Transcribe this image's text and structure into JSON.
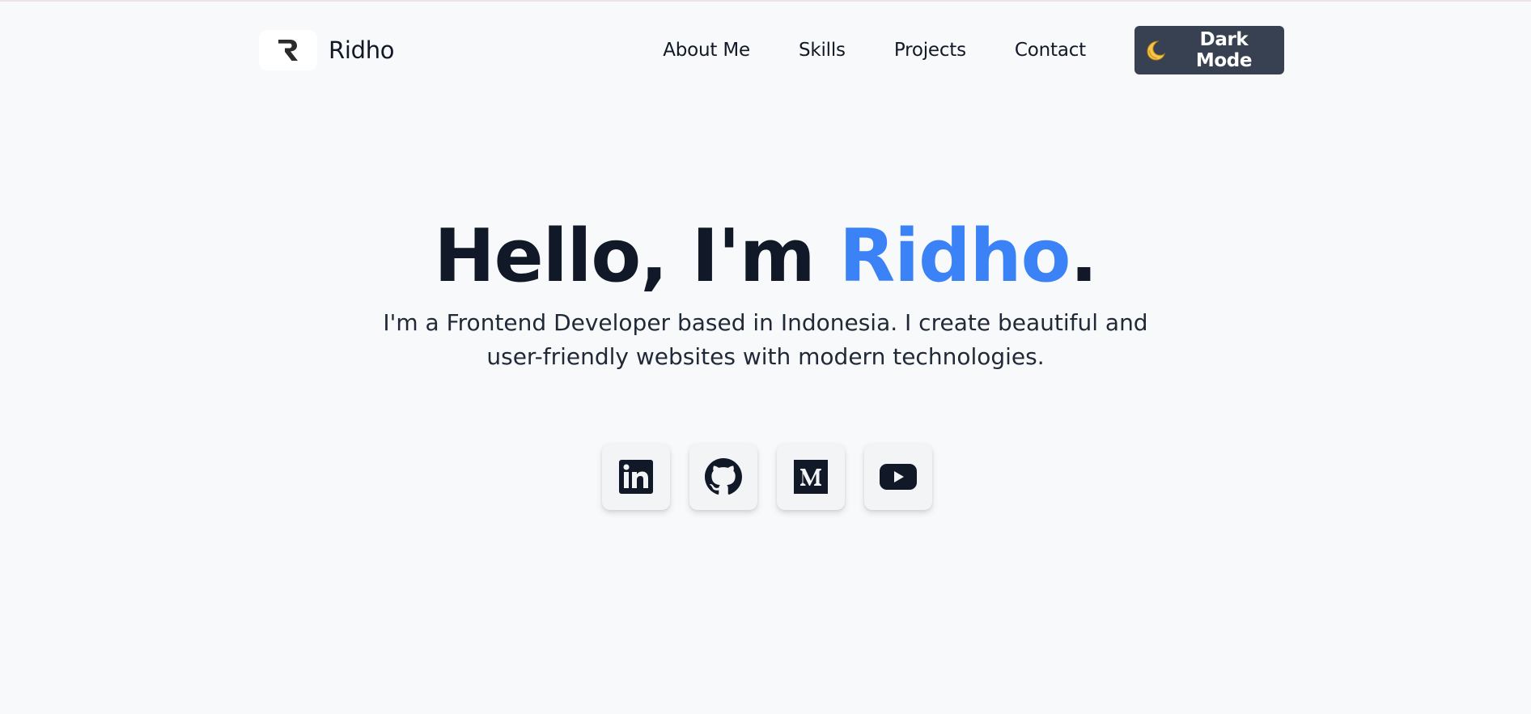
{
  "brand": {
    "name": "Ridho",
    "logo_icon": "r-logo-icon"
  },
  "nav": {
    "links": [
      "About Me",
      "Skills",
      "Projects",
      "Contact"
    ],
    "dark_mode_label": "Dark Mode",
    "dark_mode_icon": "moon-icon"
  },
  "hero": {
    "title_prefix": "Hello, I'm ",
    "title_name": "Ridho",
    "title_suffix": ".",
    "subtitle": "I'm a Frontend Developer based in Indonesia. I create beautiful and user-friendly websites with modern technologies."
  },
  "socials": [
    {
      "name": "LinkedIn",
      "icon": "linkedin-icon"
    },
    {
      "name": "GitHub",
      "icon": "github-icon"
    },
    {
      "name": "Medium",
      "icon": "medium-icon"
    },
    {
      "name": "YouTube",
      "icon": "youtube-icon"
    }
  ],
  "colors": {
    "background": "#f8f9fb",
    "text": "#111827",
    "accent": "#3b82f6",
    "button_dark": "#374151"
  }
}
